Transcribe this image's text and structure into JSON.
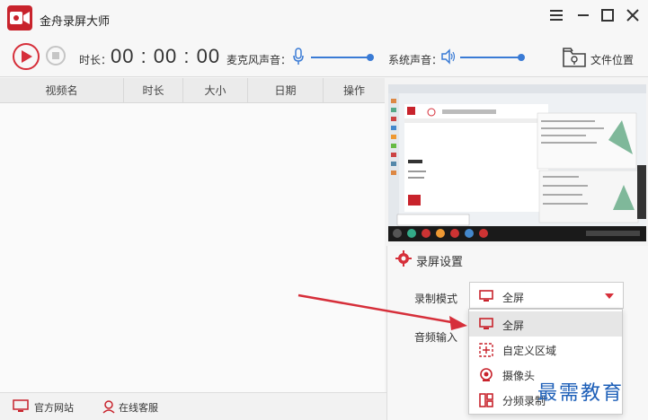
{
  "app": {
    "title": "金舟录屏大师"
  },
  "toolbar": {
    "duration_label": "时长：",
    "duration_value": "00 : 00 : 00",
    "mic_label": "麦克风声音：",
    "system_label": "系统声音：",
    "folder_label": "文件位置",
    "mic_volume": 1.0,
    "system_volume": 1.0
  },
  "table": {
    "columns": [
      "视频名",
      "时长",
      "大小",
      "日期",
      "操作"
    ]
  },
  "settings": {
    "title": "录屏设置",
    "mode_label": "录制模式",
    "audio_label": "音频输入",
    "mode_value": "全屏",
    "options": [
      {
        "label": "全屏",
        "icon": "monitor-icon"
      },
      {
        "label": "自定义区域",
        "icon": "region-icon"
      },
      {
        "label": "摄像头",
        "icon": "webcam-icon"
      },
      {
        "label": "分频录制",
        "icon": "split-icon"
      }
    ]
  },
  "statusbar": {
    "official_site": "官方网站",
    "online_support": "在线客服"
  },
  "watermark": "最需教育",
  "colors": {
    "accent_red": "#d62f3a",
    "accent_blue": "#3a7bd5"
  }
}
